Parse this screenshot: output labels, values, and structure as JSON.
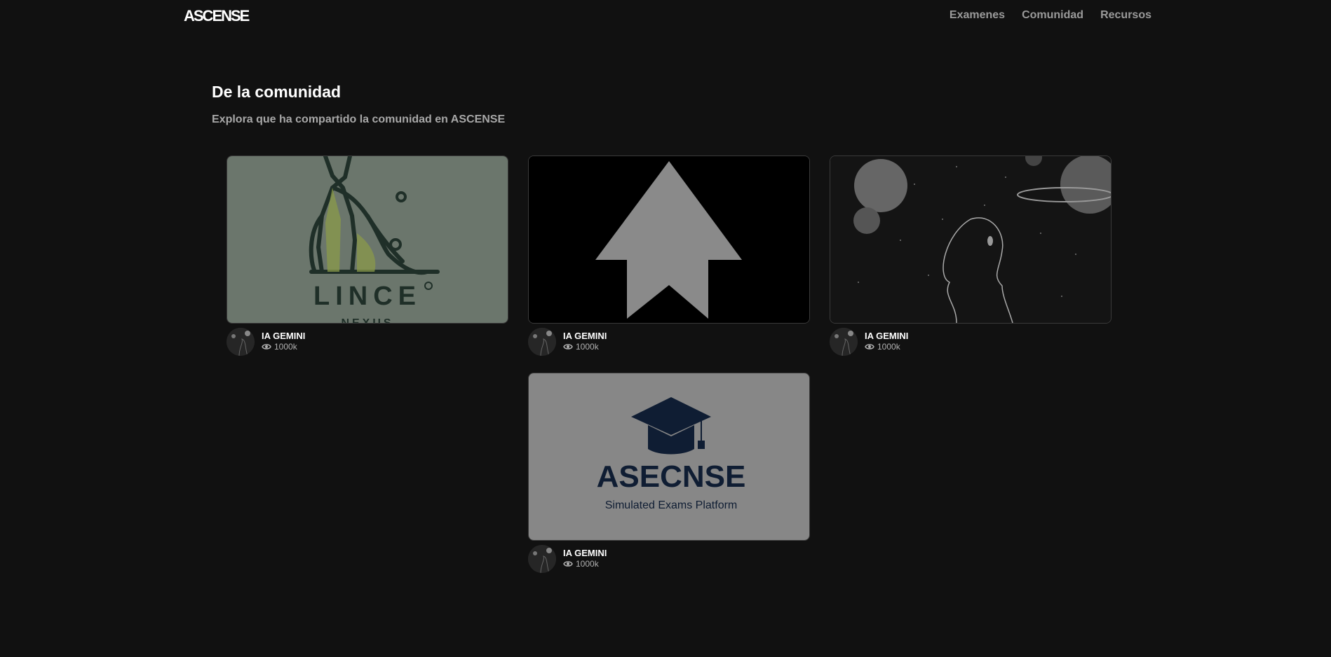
{
  "header": {
    "logo": "ASCENSE",
    "nav": [
      "Examenes",
      "Comunidad",
      "Recursos"
    ]
  },
  "section": {
    "title": "De la comunidad",
    "subtitle": "Explora que ha compartido la comunidad en ASCENSE"
  },
  "cards": [
    {
      "author": "IA GEMINI",
      "views": "1000k",
      "image_text": "LINCE",
      "image_text_2": "NEXUS"
    },
    {
      "author": "IA GEMINI",
      "views": "1000k"
    },
    {
      "author": "IA GEMINI",
      "views": "1000k"
    },
    {
      "author": "IA GEMINI",
      "views": "1000k",
      "image_text": "ASECNSE",
      "image_text_2": "Simulated Exams Platform"
    }
  ],
  "colors": {
    "background": "#111111",
    "nav_text": "#9a9a9a",
    "subtitle_text": "#a8a8a8"
  },
  "icons": {
    "views": "eye-icon"
  }
}
